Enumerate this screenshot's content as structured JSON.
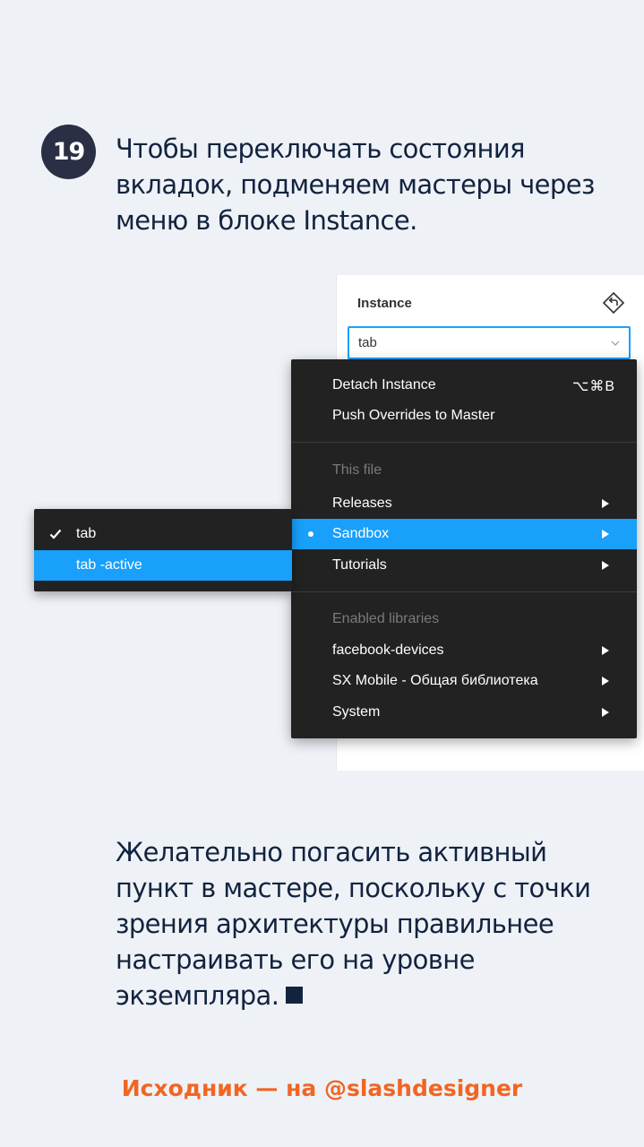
{
  "step": {
    "number": "19"
  },
  "intro_text": "Чтобы переключать состояния вкладок, подменяем мастеры через меню в блоке Instance.",
  "panel": {
    "title": "Instance",
    "reset_icon": "reset-instance-icon",
    "select_value": "tab"
  },
  "context_menu": {
    "detach": {
      "label": "Detach Instance",
      "shortcut": "⌥⌘B"
    },
    "push_overrides": {
      "label": "Push Overrides to Master"
    },
    "this_file_header": "This file",
    "releases": {
      "label": "Releases"
    },
    "sandbox": {
      "label": "Sandbox"
    },
    "tutorials": {
      "label": "Tutorials"
    },
    "libraries_header": "Enabled libraries",
    "facebook_devices": {
      "label": "facebook-devices"
    },
    "sx_mobile": {
      "label": "SX Mobile - Общая библиотека"
    },
    "system": {
      "label": "System"
    }
  },
  "submenu": {
    "items": [
      {
        "label": "tab",
        "checked": true
      },
      {
        "label": "tab -active",
        "checked": false
      }
    ]
  },
  "outro_text": "Желательно погасить активный пункт в мастере, поскольку с точки зрения архитектуры правильнее настраивать его на уровне экземпляра.",
  "credit": "Исходник — на @slashdesigner",
  "colors": {
    "accent": "#18a0fb",
    "credit": "#f26522",
    "text": "#13233f",
    "menu_bg": "#222222",
    "page_bg": "#eef2f6"
  }
}
